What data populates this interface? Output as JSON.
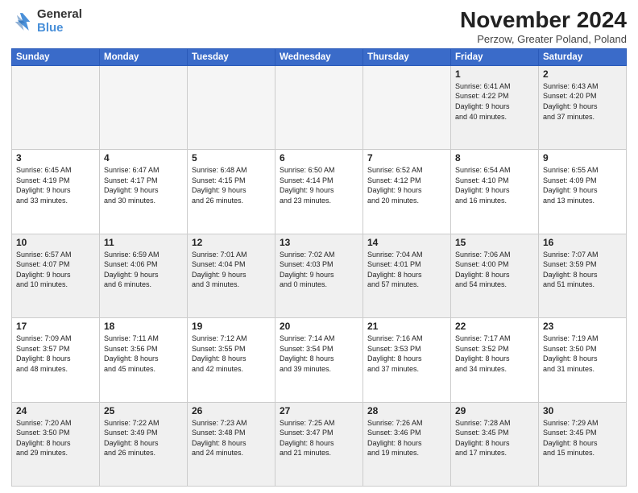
{
  "logo": {
    "line1": "General",
    "line2": "Blue"
  },
  "title": "November 2024",
  "location": "Perzow, Greater Poland, Poland",
  "headers": [
    "Sunday",
    "Monday",
    "Tuesday",
    "Wednesday",
    "Thursday",
    "Friday",
    "Saturday"
  ],
  "weeks": [
    [
      {
        "day": "",
        "info": "",
        "empty": true
      },
      {
        "day": "",
        "info": "",
        "empty": true
      },
      {
        "day": "",
        "info": "",
        "empty": true
      },
      {
        "day": "",
        "info": "",
        "empty": true
      },
      {
        "day": "",
        "info": "",
        "empty": true
      },
      {
        "day": "1",
        "info": "Sunrise: 6:41 AM\nSunset: 4:22 PM\nDaylight: 9 hours\nand 40 minutes.",
        "empty": false
      },
      {
        "day": "2",
        "info": "Sunrise: 6:43 AM\nSunset: 4:20 PM\nDaylight: 9 hours\nand 37 minutes.",
        "empty": false
      }
    ],
    [
      {
        "day": "3",
        "info": "Sunrise: 6:45 AM\nSunset: 4:19 PM\nDaylight: 9 hours\nand 33 minutes.",
        "empty": false
      },
      {
        "day": "4",
        "info": "Sunrise: 6:47 AM\nSunset: 4:17 PM\nDaylight: 9 hours\nand 30 minutes.",
        "empty": false
      },
      {
        "day": "5",
        "info": "Sunrise: 6:48 AM\nSunset: 4:15 PM\nDaylight: 9 hours\nand 26 minutes.",
        "empty": false
      },
      {
        "day": "6",
        "info": "Sunrise: 6:50 AM\nSunset: 4:14 PM\nDaylight: 9 hours\nand 23 minutes.",
        "empty": false
      },
      {
        "day": "7",
        "info": "Sunrise: 6:52 AM\nSunset: 4:12 PM\nDaylight: 9 hours\nand 20 minutes.",
        "empty": false
      },
      {
        "day": "8",
        "info": "Sunrise: 6:54 AM\nSunset: 4:10 PM\nDaylight: 9 hours\nand 16 minutes.",
        "empty": false
      },
      {
        "day": "9",
        "info": "Sunrise: 6:55 AM\nSunset: 4:09 PM\nDaylight: 9 hours\nand 13 minutes.",
        "empty": false
      }
    ],
    [
      {
        "day": "10",
        "info": "Sunrise: 6:57 AM\nSunset: 4:07 PM\nDaylight: 9 hours\nand 10 minutes.",
        "empty": false
      },
      {
        "day": "11",
        "info": "Sunrise: 6:59 AM\nSunset: 4:06 PM\nDaylight: 9 hours\nand 6 minutes.",
        "empty": false
      },
      {
        "day": "12",
        "info": "Sunrise: 7:01 AM\nSunset: 4:04 PM\nDaylight: 9 hours\nand 3 minutes.",
        "empty": false
      },
      {
        "day": "13",
        "info": "Sunrise: 7:02 AM\nSunset: 4:03 PM\nDaylight: 9 hours\nand 0 minutes.",
        "empty": false
      },
      {
        "day": "14",
        "info": "Sunrise: 7:04 AM\nSunset: 4:01 PM\nDaylight: 8 hours\nand 57 minutes.",
        "empty": false
      },
      {
        "day": "15",
        "info": "Sunrise: 7:06 AM\nSunset: 4:00 PM\nDaylight: 8 hours\nand 54 minutes.",
        "empty": false
      },
      {
        "day": "16",
        "info": "Sunrise: 7:07 AM\nSunset: 3:59 PM\nDaylight: 8 hours\nand 51 minutes.",
        "empty": false
      }
    ],
    [
      {
        "day": "17",
        "info": "Sunrise: 7:09 AM\nSunset: 3:57 PM\nDaylight: 8 hours\nand 48 minutes.",
        "empty": false
      },
      {
        "day": "18",
        "info": "Sunrise: 7:11 AM\nSunset: 3:56 PM\nDaylight: 8 hours\nand 45 minutes.",
        "empty": false
      },
      {
        "day": "19",
        "info": "Sunrise: 7:12 AM\nSunset: 3:55 PM\nDaylight: 8 hours\nand 42 minutes.",
        "empty": false
      },
      {
        "day": "20",
        "info": "Sunrise: 7:14 AM\nSunset: 3:54 PM\nDaylight: 8 hours\nand 39 minutes.",
        "empty": false
      },
      {
        "day": "21",
        "info": "Sunrise: 7:16 AM\nSunset: 3:53 PM\nDaylight: 8 hours\nand 37 minutes.",
        "empty": false
      },
      {
        "day": "22",
        "info": "Sunrise: 7:17 AM\nSunset: 3:52 PM\nDaylight: 8 hours\nand 34 minutes.",
        "empty": false
      },
      {
        "day": "23",
        "info": "Sunrise: 7:19 AM\nSunset: 3:50 PM\nDaylight: 8 hours\nand 31 minutes.",
        "empty": false
      }
    ],
    [
      {
        "day": "24",
        "info": "Sunrise: 7:20 AM\nSunset: 3:50 PM\nDaylight: 8 hours\nand 29 minutes.",
        "empty": false
      },
      {
        "day": "25",
        "info": "Sunrise: 7:22 AM\nSunset: 3:49 PM\nDaylight: 8 hours\nand 26 minutes.",
        "empty": false
      },
      {
        "day": "26",
        "info": "Sunrise: 7:23 AM\nSunset: 3:48 PM\nDaylight: 8 hours\nand 24 minutes.",
        "empty": false
      },
      {
        "day": "27",
        "info": "Sunrise: 7:25 AM\nSunset: 3:47 PM\nDaylight: 8 hours\nand 21 minutes.",
        "empty": false
      },
      {
        "day": "28",
        "info": "Sunrise: 7:26 AM\nSunset: 3:46 PM\nDaylight: 8 hours\nand 19 minutes.",
        "empty": false
      },
      {
        "day": "29",
        "info": "Sunrise: 7:28 AM\nSunset: 3:45 PM\nDaylight: 8 hours\nand 17 minutes.",
        "empty": false
      },
      {
        "day": "30",
        "info": "Sunrise: 7:29 AM\nSunset: 3:45 PM\nDaylight: 8 hours\nand 15 minutes.",
        "empty": false
      }
    ]
  ]
}
